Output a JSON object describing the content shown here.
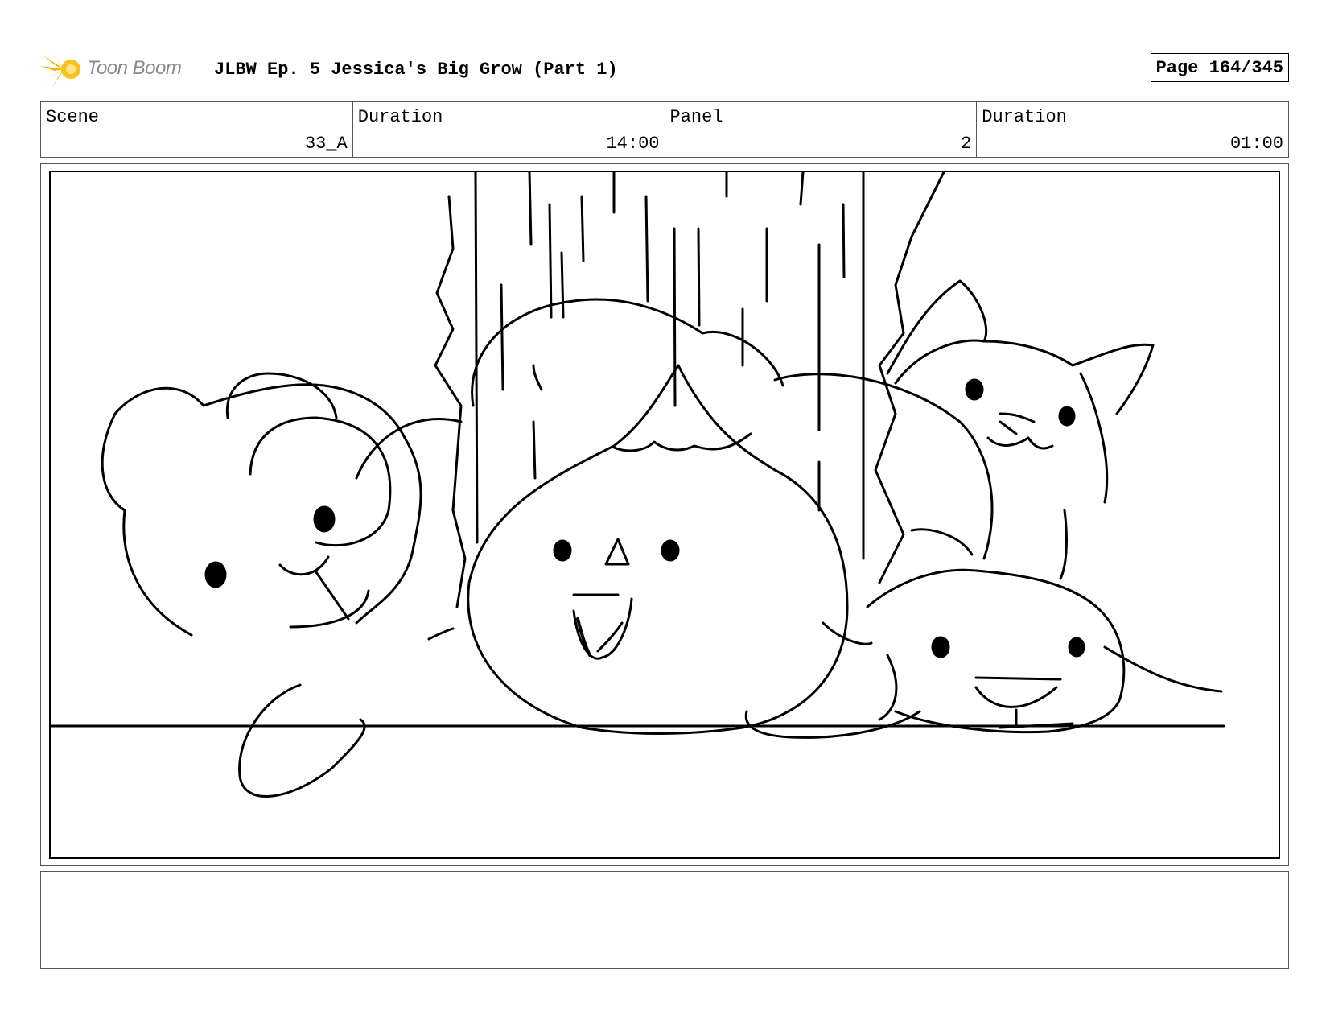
{
  "header": {
    "logo_text": "Toon Boom",
    "title": "JLBW Ep. 5 Jessica's Big Grow (Part 1)",
    "page": "Page 164/345"
  },
  "info": {
    "scene_label": "Scene",
    "scene_value": "33_A",
    "scene_duration_label": "Duration",
    "scene_duration_value": "14:00",
    "panel_label": "Panel",
    "panel_value": "2",
    "panel_duration_label": "Duration",
    "panel_duration_value": "01:00"
  },
  "panel": {
    "drawing_subjects": [
      "teddy-bear",
      "round-blob-character",
      "cat",
      "seal",
      "tree-trunk"
    ]
  },
  "notes": {
    "text": ""
  },
  "colors": {
    "logo_accent": "#f5b400",
    "logo_text": "#8a8a8a",
    "line": "#000000"
  }
}
